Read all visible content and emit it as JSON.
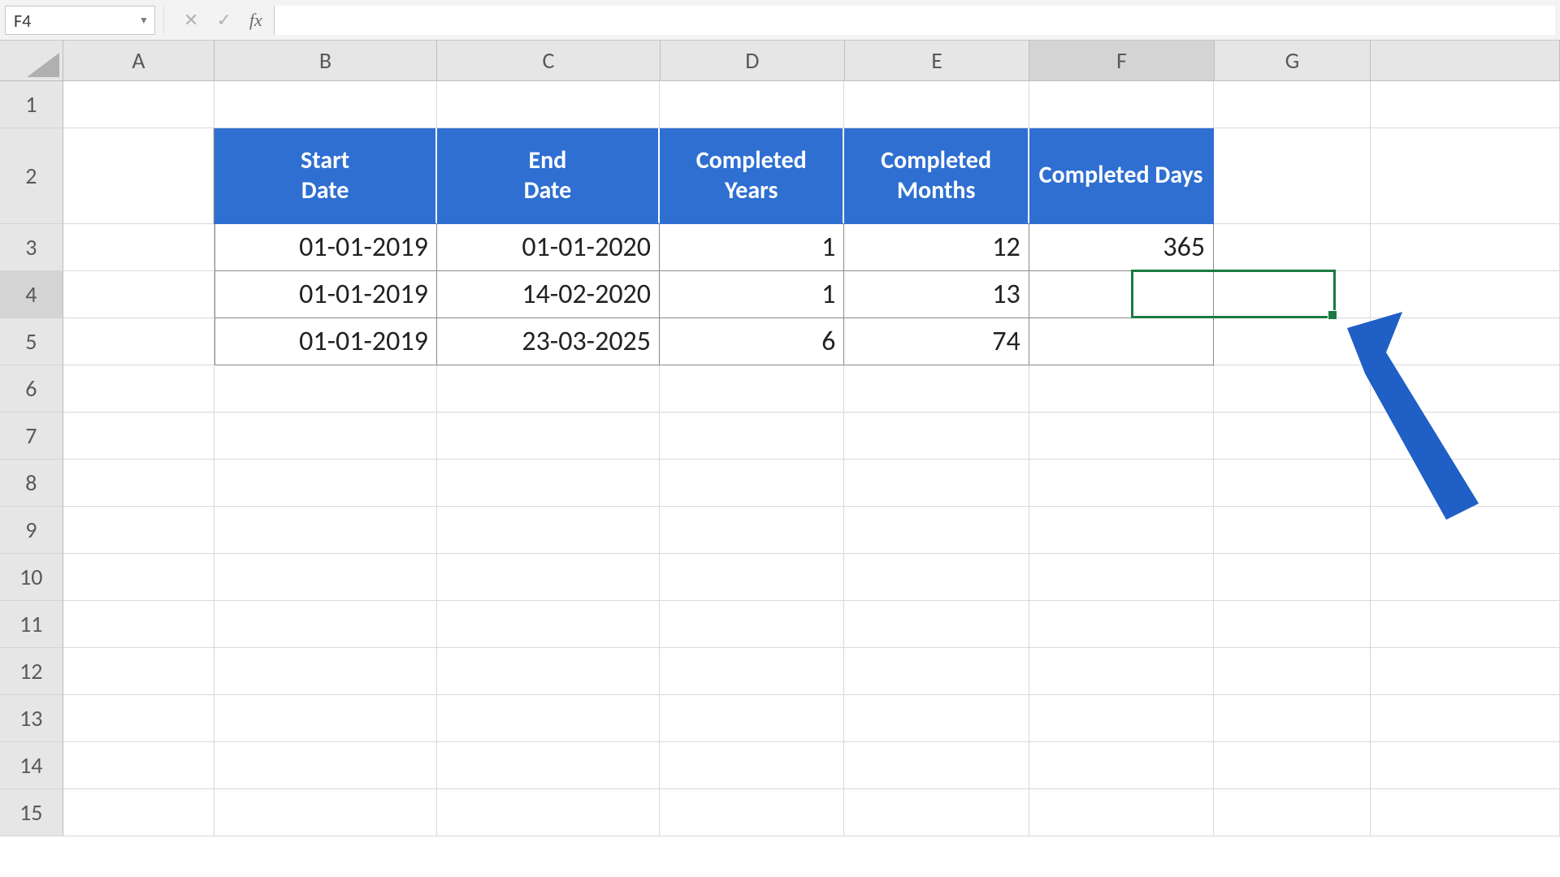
{
  "name_box": "F4",
  "formula_value": "",
  "columns": [
    "A",
    "B",
    "C",
    "D",
    "E",
    "F",
    "G"
  ],
  "active_column": "F",
  "rows": [
    1,
    2,
    3,
    4,
    5,
    6,
    7,
    8,
    9,
    10,
    11,
    12,
    13,
    14,
    15
  ],
  "active_row": 4,
  "table": {
    "headers": {
      "B": "Start\nDate",
      "C": "End\nDate",
      "D": "Completed Years",
      "E": "Completed Months",
      "F": "Completed Days"
    },
    "rows": [
      {
        "B": "01-01-2019",
        "C": "01-01-2020",
        "D": "1",
        "E": "12",
        "F": "365"
      },
      {
        "B": "01-01-2019",
        "C": "14-02-2020",
        "D": "1",
        "E": "13",
        "F": ""
      },
      {
        "B": "01-01-2019",
        "C": "23-03-2025",
        "D": "6",
        "E": "74",
        "F": ""
      }
    ]
  },
  "colors": {
    "table_header": "#2e6fd1",
    "selection": "#1a7a42"
  },
  "icons": {
    "dropdown": "chevron-down-icon",
    "cancel": "close-icon",
    "confirm": "check-icon",
    "fx": "fx-icon"
  }
}
